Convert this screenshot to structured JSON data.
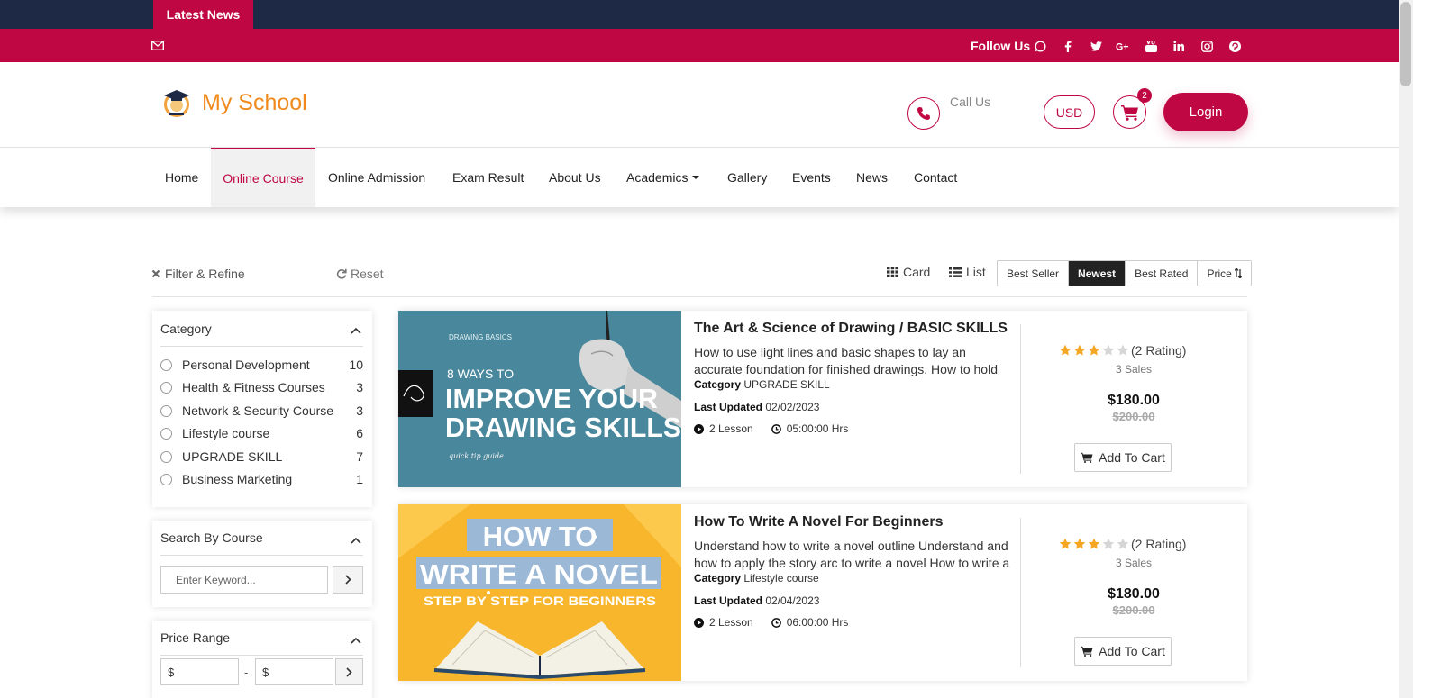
{
  "topbar": {
    "latest_news": "Latest News"
  },
  "socialbar": {
    "follow_label": "Follow Us",
    "icons": [
      "whatsapp-icon",
      "facebook-icon",
      "twitter-icon",
      "google-plus-icon",
      "youtube-icon",
      "linkedin-icon",
      "instagram-icon",
      "pinterest-icon"
    ]
  },
  "header": {
    "logo_text": "My School",
    "call_label": "Call Us",
    "currency": "USD",
    "cart_count": "2",
    "login_label": "Login"
  },
  "nav": {
    "items": [
      "Home",
      "Online Course",
      "Online Admission",
      "Exam Result",
      "About Us",
      "Academics",
      "Gallery",
      "Events",
      "News",
      "Contact"
    ],
    "active": "Online Course"
  },
  "toolbar": {
    "filter_label": "Filter & Refine",
    "reset_label": "Reset",
    "card_label": "Card",
    "list_label": "List",
    "sort": [
      "Best Seller",
      "Newest",
      "Best Rated",
      "Price"
    ],
    "sort_active": "Newest"
  },
  "sidebar": {
    "category": {
      "title": "Category",
      "items": [
        {
          "label": "Personal Development",
          "count": "10"
        },
        {
          "label": "Health & Fitness Courses",
          "count": "3"
        },
        {
          "label": "Network & Security Course",
          "count": "3"
        },
        {
          "label": "Lifestyle course",
          "count": "6"
        },
        {
          "label": "UPGRADE SKILL",
          "count": "7"
        },
        {
          "label": "Business Marketing",
          "count": "1"
        }
      ]
    },
    "search": {
      "title": "Search By Course",
      "placeholder": "Enter Keyword..."
    },
    "price": {
      "title": "Price Range",
      "min_prefix": "$",
      "max_prefix": "$",
      "separator": "-"
    }
  },
  "courses": [
    {
      "title": "The Art & Science of Drawing / BASIC SKILLS",
      "description": "How to use light lines and basic shapes to lay an accurate foundation for finished drawings. How to hold",
      "category_label": "Category",
      "category": "UPGRADE SKILL",
      "updated_label": "Last Updated",
      "updated": "02/02/2023",
      "lessons": "2 Lesson",
      "duration": "05:00:00 Hrs",
      "rating": 3,
      "rating_text": "(2 Rating)",
      "sales": "3 Sales",
      "price": "$180.00",
      "old_price": "$200.00",
      "cart_label": "Add To Cart",
      "thumb": {
        "kicker": "DRAWING BASICS",
        "line1": "8 WAYS TO",
        "line2": "IMPROVE YOUR",
        "line3": "DRAWING SKILLS",
        "footer": "quick tip guide",
        "bg": "#4f8fa3"
      }
    },
    {
      "title": "How To Write A Novel For Beginners",
      "description": "Understand how to write a novel outline Understand and how to apply the story arc to write a novel How to write a",
      "category_label": "Category",
      "category": "Lifestyle course",
      "updated_label": "Last Updated",
      "updated": "02/04/2023",
      "lessons": "2 Lesson",
      "duration": "06:00:00 Hrs",
      "rating": 3,
      "rating_text": "(2 Rating)",
      "sales": "3 Sales",
      "price": "$180.00",
      "old_price": "$200.00",
      "cart_label": "Add To Cart",
      "thumb": {
        "line1": "HOW TO",
        "line2": "WRITE A NOVEL",
        "line3": "STEP BY STEP FOR BEGINNERS",
        "bg": "#f7b62c"
      }
    }
  ],
  "colors": {
    "brand": "#bf0843",
    "navy": "#1e2a45",
    "logo": "#f08a1c",
    "star": "#f5a623"
  }
}
